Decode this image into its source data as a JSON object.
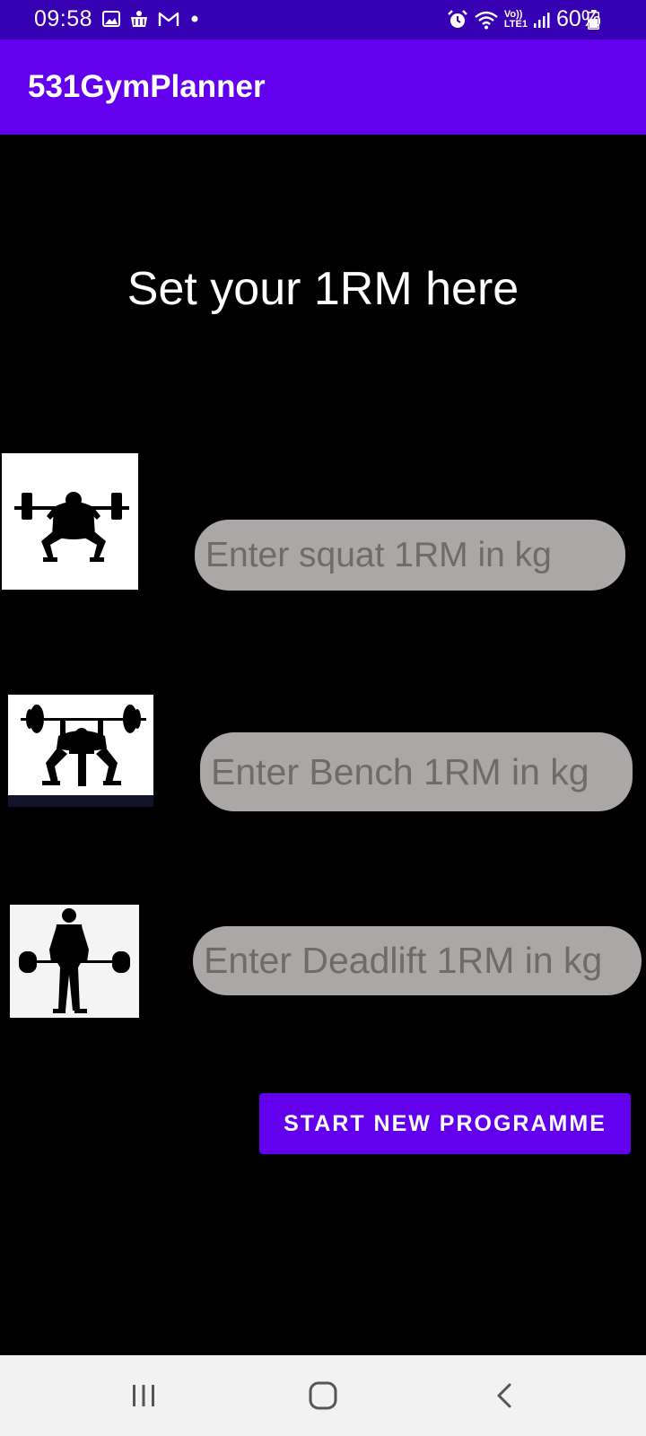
{
  "status_bar": {
    "time": "09:58",
    "battery_text": "60%",
    "battery_level": 0.6,
    "left_icons": [
      "gallery-icon",
      "app-notification-icon",
      "gmail-icon",
      "more-dot-icon"
    ],
    "right_icons": [
      "alarm-icon",
      "wifi-icon",
      "volte-lte-icon",
      "signal-icon",
      "battery-icon"
    ],
    "lte_label_top": "Vo))",
    "lte_label_bottom": "LTE1"
  },
  "app_bar": {
    "title": "531GymPlanner",
    "color": "#6200EE"
  },
  "main": {
    "heading": "Set your 1RM here",
    "lifts": [
      {
        "name": "squat",
        "image_icon": "squat-silhouette-icon",
        "placeholder": "Enter squat 1RM in kg",
        "value": ""
      },
      {
        "name": "bench",
        "image_icon": "bench-press-silhouette-icon",
        "placeholder": "Enter Bench 1RM in kg",
        "value": ""
      },
      {
        "name": "deadlift",
        "image_icon": "deadlift-silhouette-icon",
        "placeholder": "Enter Deadlift 1RM in kg",
        "value": ""
      }
    ],
    "start_button_label": "START NEW PROGRAMME"
  },
  "nav_bar": {
    "items": [
      "recent-apps-icon",
      "home-icon",
      "back-icon"
    ]
  },
  "colors": {
    "status_bar": "#3700B3",
    "accent": "#6200EE",
    "background": "#000000",
    "input_background": "#ABA7A7",
    "input_placeholder": "#6f6b6b",
    "nav_bar": "#F2F2F2"
  }
}
